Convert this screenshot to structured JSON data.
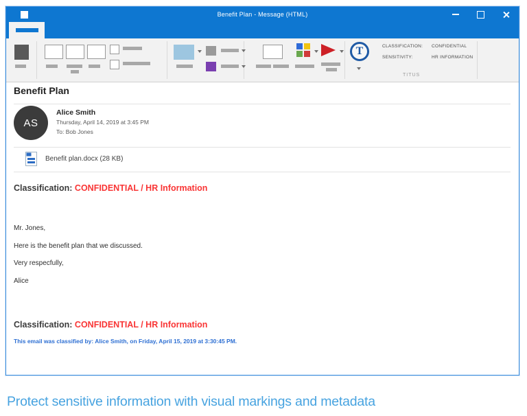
{
  "window": {
    "title": "Benefit Plan - Message (HTML)",
    "controls": [
      "minimize",
      "maximize",
      "close"
    ]
  },
  "ribbon": {
    "titus": {
      "logo": "T",
      "group_label": "TITUS",
      "fields": [
        {
          "label": "CLASSIFICATION:",
          "value": "CONFIDENTIAL"
        },
        {
          "label": "SENSITIVITY:",
          "value": "HR INFORMATION"
        }
      ]
    }
  },
  "email": {
    "subject": "Benefit Plan",
    "sender": {
      "initials": "AS",
      "name": "Alice Smith",
      "date": "Thursday, April 14, 2019 at 3:45 PM",
      "to": "To: Bob Jones"
    },
    "attachment": {
      "name": "Benefit plan.docx (28 KB)"
    },
    "classification": {
      "label": "Classification:",
      "value": "CONFIDENTIAL / HR Information"
    },
    "body": [
      "Mr. Jones,",
      "Here is the benefit plan that we discussed.",
      "Very respecfully,",
      "Alice"
    ],
    "footer_classification": {
      "label": "Classification:",
      "value": "CONFIDENTIAL / HR Information"
    },
    "classified_by": "This email was classified by: Alice Smith, on Friday, April 15, 2019 at 3:30:45 PM."
  },
  "caption": "Protect sensitive information with visual markings and metadata",
  "colors": {
    "titlebar_blue": "#0e77d1",
    "ribbon_bg": "#f2f2f2",
    "classification_red": "#f93535",
    "classified_by_blue": "#2d6fd3",
    "caption_blue": "#47a3e0",
    "titus_blue": "#1f5aa5",
    "placeholder_gray": "#a8a8a8",
    "dark_square": "#595959",
    "light_blue_swatch": "#9dc6e0",
    "purple_swatch": "#7a3fb0",
    "quad_blue": "#2f6bd7",
    "quad_yellow": "#f2c40f",
    "quad_green": "#69a74e",
    "quad_red": "#d03a3a",
    "flag_red": "#cd2026",
    "window_border": "#3c8ede"
  }
}
